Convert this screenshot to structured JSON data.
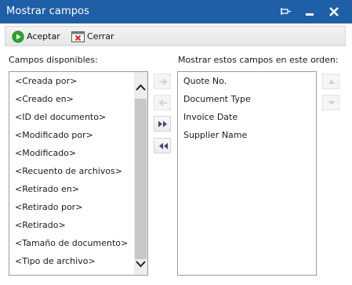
{
  "window": {
    "title": "Mostrar campos"
  },
  "toolbar": {
    "accept_label": "Aceptar",
    "close_label": "Cerrar"
  },
  "available_fields": {
    "label": "Campos disponibles:",
    "items": [
      "<Creada por>",
      "<Creado en>",
      "<ID del documento>",
      "<Modificado por>",
      "<Modificado>",
      "<Recuento de archivos>",
      "<Retirado en>",
      "<Retirado por>",
      "<Retirado>",
      "<Tamaño de documento>",
      "<Tipo de archivo>"
    ]
  },
  "shown_fields": {
    "label": "Mostrar estos campos en este orden:",
    "items": [
      "Quote No.",
      "Document Type",
      "Invoice Date",
      "Supplier Name"
    ]
  },
  "colors": {
    "title_bar": "#1f5fa8",
    "accept_green": "#2fa62f",
    "close_red": "#d9261c"
  },
  "icons": {
    "pin": "pin-icon",
    "minimize": "minimize-icon",
    "close": "close-icon",
    "accept": "check-circle-icon",
    "cerrar": "close-window-icon",
    "add": "arrow-right-icon",
    "remove": "arrow-left-icon",
    "add_all": "double-arrow-right-icon",
    "remove_all": "double-arrow-left-icon",
    "move_up": "arrow-up-icon",
    "move_down": "arrow-down-icon"
  },
  "states": {
    "add_enabled": false,
    "remove_enabled": false,
    "add_all_enabled": true,
    "remove_all_enabled": true,
    "move_up_enabled": false,
    "move_down_enabled": false
  }
}
